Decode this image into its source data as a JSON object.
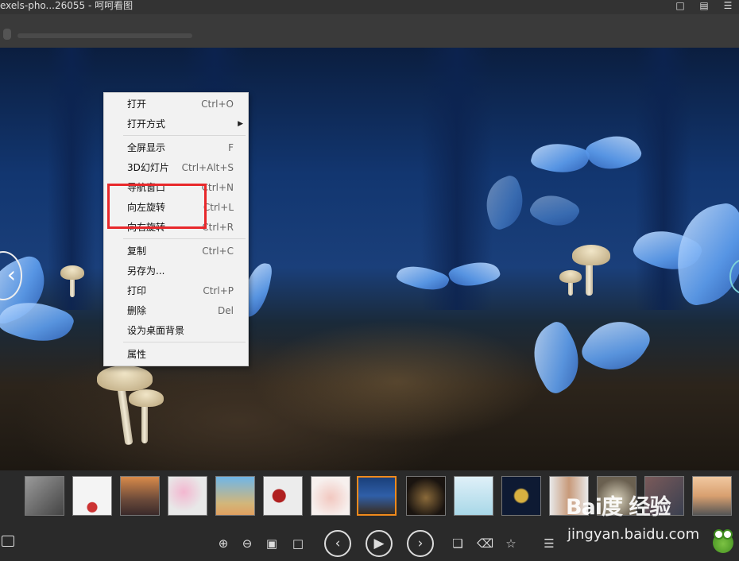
{
  "window": {
    "title": "exels-pho...26055  -  呵呵看图",
    "icons": [
      "chat-icon",
      "feedback-icon",
      "menu-icon"
    ]
  },
  "menu": {
    "items": [
      {
        "label": "打开",
        "shortcut": "Ctrl+O"
      },
      {
        "label": "打开方式",
        "shortcut": "",
        "submenu": true
      },
      {
        "label": "全屏显示",
        "shortcut": "F"
      },
      {
        "label": "3D幻灯片",
        "shortcut": "Ctrl+Alt+S"
      },
      {
        "label": "导航窗口",
        "shortcut": "Ctrl+N"
      },
      {
        "label": "向左旋转",
        "shortcut": "Ctrl+L"
      },
      {
        "label": "向右旋转",
        "shortcut": "Ctrl+R"
      },
      {
        "label": "复制",
        "shortcut": "Ctrl+C"
      },
      {
        "label": "另存为...",
        "shortcut": ""
      },
      {
        "label": "打印",
        "shortcut": "Ctrl+P"
      },
      {
        "label": "删除",
        "shortcut": "Del"
      },
      {
        "label": "设为桌面背景",
        "shortcut": ""
      },
      {
        "label": "属性",
        "shortcut": ""
      }
    ],
    "highlight_color": "#e8282b"
  },
  "thumbnails": {
    "count": 15,
    "selected_index": 7,
    "selected_border_color": "#f08a1c"
  },
  "controls": {
    "zoom_in_icon": "zoom-in-icon",
    "zoom_out_icon": "zoom-out-icon",
    "prev_glyph": "‹",
    "play_glyph": "▶",
    "next_glyph": "›"
  },
  "watermark": {
    "main": "Bai度 经验",
    "sub": "jingyan.baidu.com"
  }
}
